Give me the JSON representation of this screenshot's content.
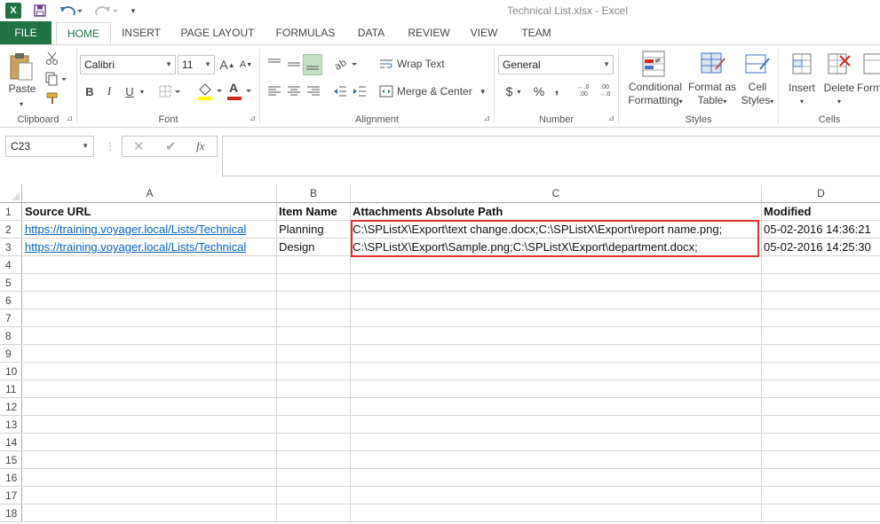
{
  "title_bar": {
    "app_icon": "X",
    "window_title": "Technical List.xlsx - Excel",
    "icons": [
      "excel-icon",
      "save-icon",
      "undo-icon",
      "redo-icon",
      "customize-qat-icon"
    ]
  },
  "tabs": [
    {
      "label": "FILE"
    },
    {
      "label": "HOME",
      "active": true
    },
    {
      "label": "INSERT"
    },
    {
      "label": "PAGE LAYOUT"
    },
    {
      "label": "FORMULAS"
    },
    {
      "label": "DATA"
    },
    {
      "label": "REVIEW"
    },
    {
      "label": "VIEW"
    },
    {
      "label": "TEAM"
    }
  ],
  "ribbon": {
    "clipboard": {
      "label": "Clipboard",
      "paste": "Paste"
    },
    "font": {
      "label": "Font",
      "font_name": "Calibri",
      "font_size": "11",
      "bold": "B",
      "italic": "I",
      "underline": "U",
      "grow": "A",
      "shrink": "A",
      "font_color_letter": "A"
    },
    "alignment": {
      "label": "Alignment",
      "wrap_text": "Wrap Text",
      "merge_center": "Merge & Center"
    },
    "number": {
      "label": "Number",
      "format": "General",
      "currency": "$",
      "percent": "%",
      "comma": ",",
      "inc_decimal": "←.0 .00",
      "dec_decimal": ".00 →.0"
    },
    "styles": {
      "label": "Styles",
      "conditional_line1": "Conditional",
      "conditional_line2": "Formatting",
      "format_table_line1": "Format as",
      "format_table_line2": "Table",
      "cell_styles_line1": "Cell",
      "cell_styles_line2": "Styles"
    },
    "cells": {
      "label": "Cells",
      "insert": "Insert",
      "delete": "Delete",
      "format": "Form"
    },
    "colors": {
      "accent": "#217346",
      "font_color_bar": "#d7261e",
      "fill_color_bar": "#ffff00"
    }
  },
  "formula_bar": {
    "name_box": "C23",
    "fx": "fx",
    "cancel": "✕",
    "enter": "✔",
    "content": ""
  },
  "sheet": {
    "columns": [
      "A",
      "B",
      "C",
      "D"
    ],
    "row_numbers": [
      "1",
      "2",
      "3",
      "4",
      "5",
      "6",
      "7",
      "8",
      "9",
      "10",
      "11",
      "12",
      "13",
      "14",
      "15",
      "16",
      "17",
      "18"
    ],
    "header_row": {
      "A": "Source URL",
      "B": "Item Name",
      "C": "Attachments Absolute Path",
      "D": "Modified"
    },
    "data_rows": [
      {
        "A": "https://training.voyager.local/Lists/Technical",
        "B": "Planning",
        "C": "C:\\SPListX\\Export\\text change.docx;C:\\SPListX\\Export\\report name.png;",
        "D": "05-02-2016 14:36:21"
      },
      {
        "A": "https://training.voyager.local/Lists/Technical",
        "B": "Design",
        "C": "C:\\SPListX\\Export\\Sample.png;C:\\SPListX\\Export\\department.docx;",
        "D": "05-02-2016 14:25:30"
      }
    ],
    "colors": {
      "link": "#0563c1",
      "highlight": "#e0312b"
    }
  }
}
